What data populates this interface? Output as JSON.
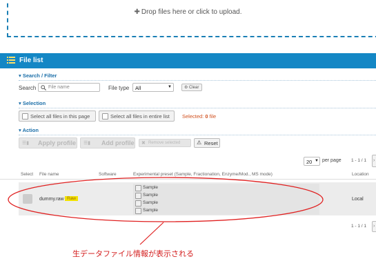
{
  "dropzone": {
    "icon": "plus-icon",
    "text": "Drop files here or click to upload."
  },
  "filelist": {
    "icon": "list-icon",
    "title": "File list"
  },
  "search": {
    "section_title": "▾ Search / Filter",
    "search_label": "Search",
    "search_placeholder": "File name",
    "filetype_label": "File type",
    "filetype_value": "All",
    "clear_label": "Clear"
  },
  "selection": {
    "section_title": "▾ Selection",
    "select_page_label": "Select all files in this page",
    "select_all_label": "Select all files in entire list",
    "selected_prefix": "Selected:",
    "selected_count": "0",
    "selected_suffix": "file"
  },
  "action": {
    "section_title": "▾ Action",
    "apply_profile_label": "Apply profile",
    "add_profile_label": "Add profile",
    "remove_selected_label": "Remove selected",
    "reset_label": "Reset"
  },
  "pagination": {
    "per_page_value": "20",
    "per_page_label": "per page",
    "range_top": "1 - 1 / 1",
    "range_bottom": "1 - 1 / 1"
  },
  "table": {
    "headers": [
      "Select",
      "File name",
      "Software",
      "Experimental preset (Sample, Fractionation, Enzyme/Mod., MS mode)",
      "Location"
    ],
    "rows": [
      {
        "file_name": "dummy.raw",
        "badge": "Raw",
        "presets": [
          "Sample",
          "Sample",
          "Sample",
          "Sample"
        ],
        "location": "Local"
      }
    ]
  },
  "annotation": {
    "caption": "生データファイル情報が表示される",
    "color": "#e02020"
  },
  "colors": {
    "accent": "#1487c5",
    "section": "#1a6ea8",
    "badge": "#f2e200"
  }
}
